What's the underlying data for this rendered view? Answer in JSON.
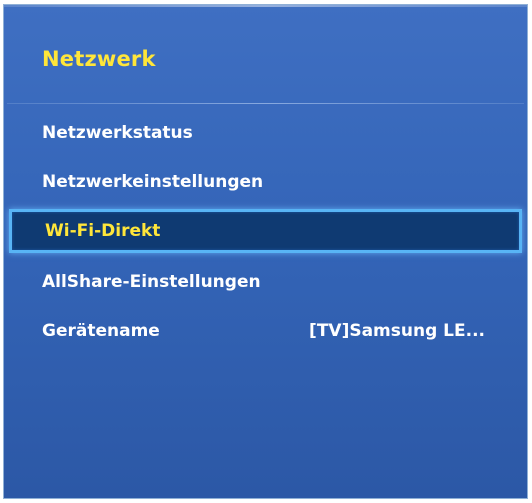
{
  "menu": {
    "title": "Netzwerk",
    "items": [
      {
        "label": "Netzwerkstatus",
        "value": ""
      },
      {
        "label": "Netzwerkeinstellungen",
        "value": ""
      },
      {
        "label": "Wi-Fi-Direkt",
        "value": "",
        "selected": true
      },
      {
        "label": "AllShare-Einstellungen",
        "value": ""
      },
      {
        "label": "Gerätename",
        "value": "[TV]Samsung LE..."
      }
    ]
  },
  "colors": {
    "panel_background": "#3465b8",
    "title_text": "#ffe63a",
    "item_text": "#ffffff",
    "selected_background": "#0f3a72",
    "selected_border": "#58b4f5",
    "selected_text": "#ffe63a"
  }
}
